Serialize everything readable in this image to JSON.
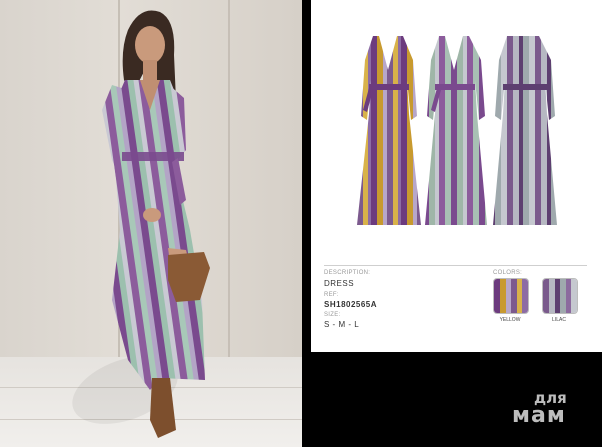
{
  "product": {
    "description_label": "DESCRIPTION:",
    "description_value": "DRESS",
    "ref_label": "REF:",
    "ref_value": "SH1802565A",
    "size_label": "SIZE:",
    "size_value": "S - M - L",
    "colors_label": "COLORS:",
    "colors": [
      {
        "name": "YELLOW",
        "stripes": [
          "#6c3b7e",
          "#c89a2f",
          "#b7a7c9",
          "#7c5a8e",
          "#d8b24a",
          "#8d6ca4"
        ]
      },
      {
        "name": "LILAC",
        "stripes": [
          "#7a5a8c",
          "#b6b8c2",
          "#5d3f70",
          "#9fa9ad",
          "#8c6a9e",
          "#c5c8cf"
        ]
      }
    ]
  },
  "colors": {
    "purple": "#6c3b7e",
    "mustard": "#c89a2f",
    "sage": "#9fb6a8",
    "silver": "#c5c8cf",
    "boot": "#8a5a35"
  },
  "watermark": {
    "line1": "для",
    "line2": "мам"
  }
}
